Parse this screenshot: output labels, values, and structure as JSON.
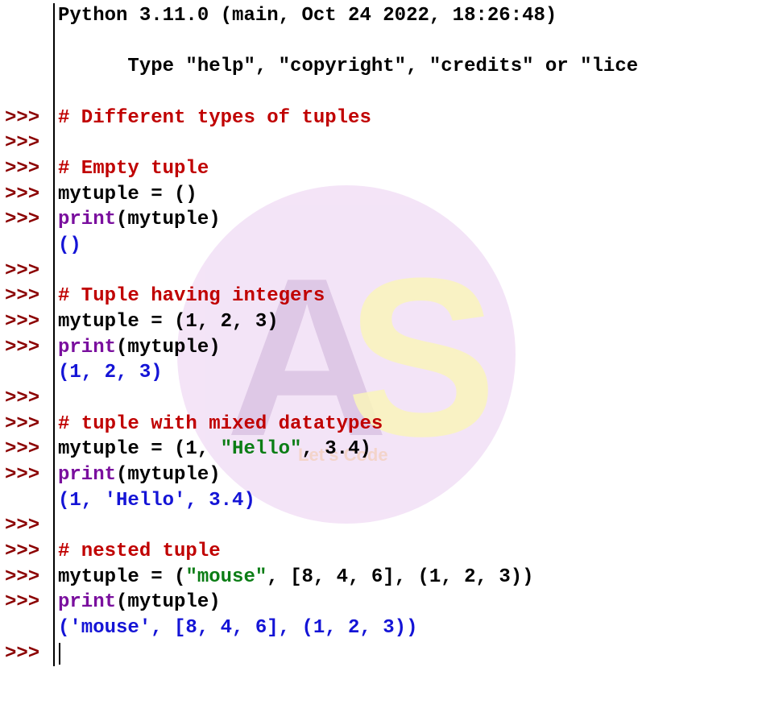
{
  "watermark": {
    "letter_a": "A",
    "letter_s": "S",
    "subtitle": "Let's Code"
  },
  "header": {
    "line1": "Python 3.11.0 (main, Oct 24 2022, 18:26:48) ",
    "line2_a": "Type \"help\", \"copyright\", \"credits\" or \"lic",
    "line2_b": "e"
  },
  "prompt": ">>>",
  "lines": {
    "c1": "# Different types of tuples",
    "c2": "# Empty tuple",
    "a1": "mytuple = ()",
    "p1_func": "print",
    "p1_args": "(mytuple)",
    "o1": "()",
    "c3": "# Tuple having integers",
    "a2": "mytuple = (1, 2, 3)",
    "o2": "(1, 2, 3)",
    "c4": "# tuple with mixed datatypes",
    "a3_a": "mytuple = (1, ",
    "a3_s": "\"Hello\"",
    "a3_b": ", 3.4)",
    "o3": "(1, 'Hello', 3.4)",
    "c5": "# nested tuple",
    "a4_a": "mytuple = (",
    "a4_s": "\"mouse\"",
    "a4_b": ", [8, 4, 6], (1, 2, 3))",
    "o4": "('mouse', [8, 4, 6], (1, 2, 3))"
  }
}
